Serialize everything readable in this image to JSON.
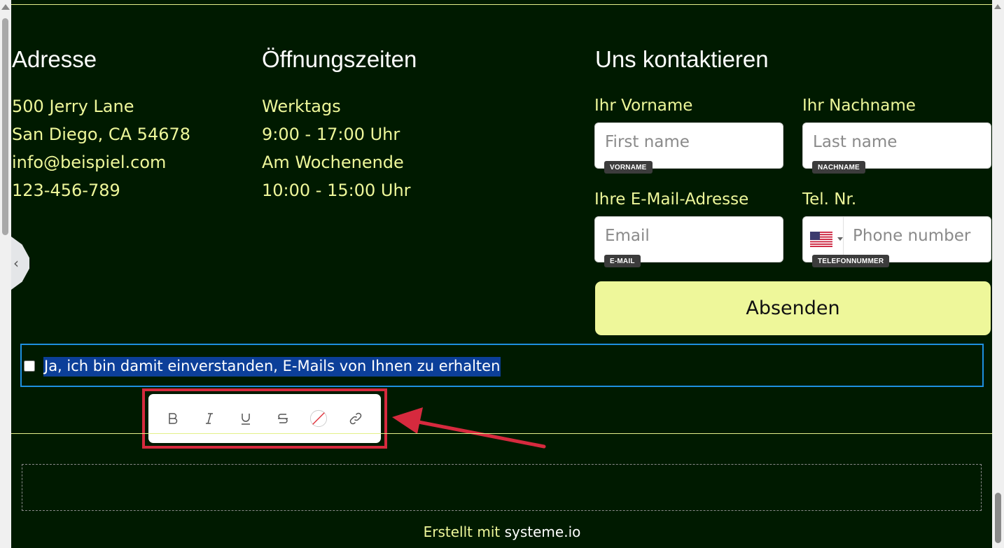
{
  "address": {
    "title": "Adresse",
    "lines": [
      "500 Jerry Lane",
      "San Diego, CA 54678",
      "info@beispiel.com",
      "123-456-789"
    ]
  },
  "hours": {
    "title": "Öffnungszeiten",
    "lines": [
      "Werktags",
      "9:00 - 17:00 Uhr",
      "Am Wochenende",
      "10:00 - 15:00 Uhr"
    ]
  },
  "contact": {
    "title": "Uns kontaktieren",
    "first_name": {
      "label": "Ihr Vorname",
      "placeholder": "First name",
      "tag": "VORNAME"
    },
    "last_name": {
      "label": "Ihr Nachname",
      "placeholder": "Last name",
      "tag": "NACHNAME"
    },
    "email": {
      "label": "Ihre E-Mail-Adresse",
      "placeholder": "Email",
      "tag": "E-MAIL"
    },
    "phone": {
      "label": "Tel. Nr.",
      "placeholder": "Phone number",
      "tag": "TELEFONNUMMER",
      "country_flag": "us-flag-icon"
    },
    "submit_label": "Absenden"
  },
  "consent": {
    "text": "Ja, ich bin damit einverstanden, E-Mails von Ihnen zu erhalten",
    "checked": false
  },
  "toolbar": {
    "items": [
      "bold-icon",
      "italic-icon",
      "underline-icon",
      "strikethrough-icon",
      "text-color-icon",
      "link-icon"
    ]
  },
  "footer": {
    "prefix": "Erstellt mit",
    "brand": "systeme.io"
  },
  "colors": {
    "background": "#001a00",
    "accent": "#eef79a",
    "selection": "#0c3f99",
    "focus_border": "#1e8fe0",
    "annotation": "#d62a3e"
  }
}
